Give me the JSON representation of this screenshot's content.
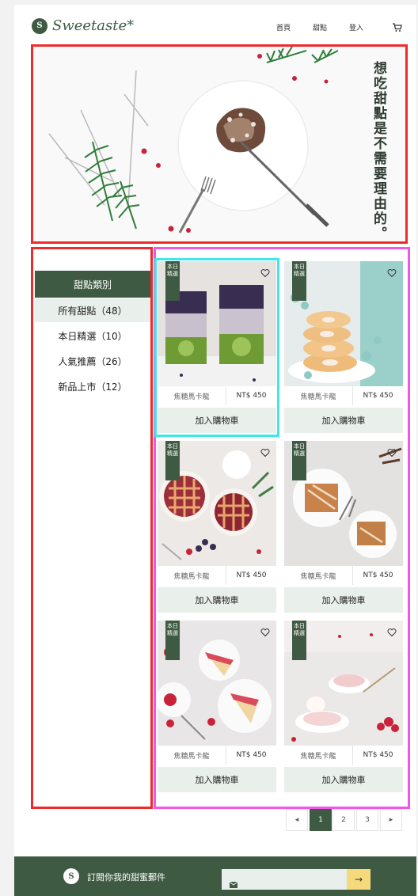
{
  "header": {
    "logo_mark": "S",
    "logo_text": "Sweetaste*",
    "nav": [
      {
        "label": "首頁"
      },
      {
        "label": "甜點"
      },
      {
        "label": "登入"
      }
    ]
  },
  "hero": {
    "slogan": "想吃甜點是不需要理由的。"
  },
  "sidebar": {
    "title": "甜點類別",
    "items": [
      {
        "label": "所有甜點（48）"
      },
      {
        "label": "本日精選（10）"
      },
      {
        "label": "人氣推薦（26）"
      },
      {
        "label": "新品上市（12）"
      }
    ]
  },
  "products": [
    {
      "badge": "本日精選",
      "name": "焦糖馬卡龍",
      "price": "NT$ 450",
      "button": "加入購物車"
    },
    {
      "badge": "本日精選",
      "name": "焦糖馬卡龍",
      "price": "NT$ 450",
      "button": "加入購物車"
    },
    {
      "badge": "本日精選",
      "name": "焦糖馬卡龍",
      "price": "NT$ 450",
      "button": "加入購物車"
    },
    {
      "badge": "本日精選",
      "name": "焦糖馬卡龍",
      "price": "NT$ 450",
      "button": "加入購物車"
    },
    {
      "badge": "本日精選",
      "name": "焦糖馬卡龍",
      "price": "NT$ 450",
      "button": "加入購物車"
    },
    {
      "badge": "本日精選",
      "name": "焦糖馬卡龍",
      "price": "NT$ 450",
      "button": "加入購物車"
    }
  ],
  "pagination": {
    "prev": "◂",
    "pages": [
      "1",
      "2",
      "3"
    ],
    "next": "▸",
    "current": "1"
  },
  "footer": {
    "mark": "S",
    "text": "訂閱你我的甜蜜郵件",
    "email_placeholder": "",
    "send": "→"
  },
  "colors": {
    "brand": "#3f5a43",
    "light": "#e9efea",
    "accent": "#f6d97a"
  },
  "icons": {
    "cart": "cart-icon",
    "heart": "heart-icon",
    "mail": "mail-icon",
    "arrow": "arrow-right-icon"
  }
}
